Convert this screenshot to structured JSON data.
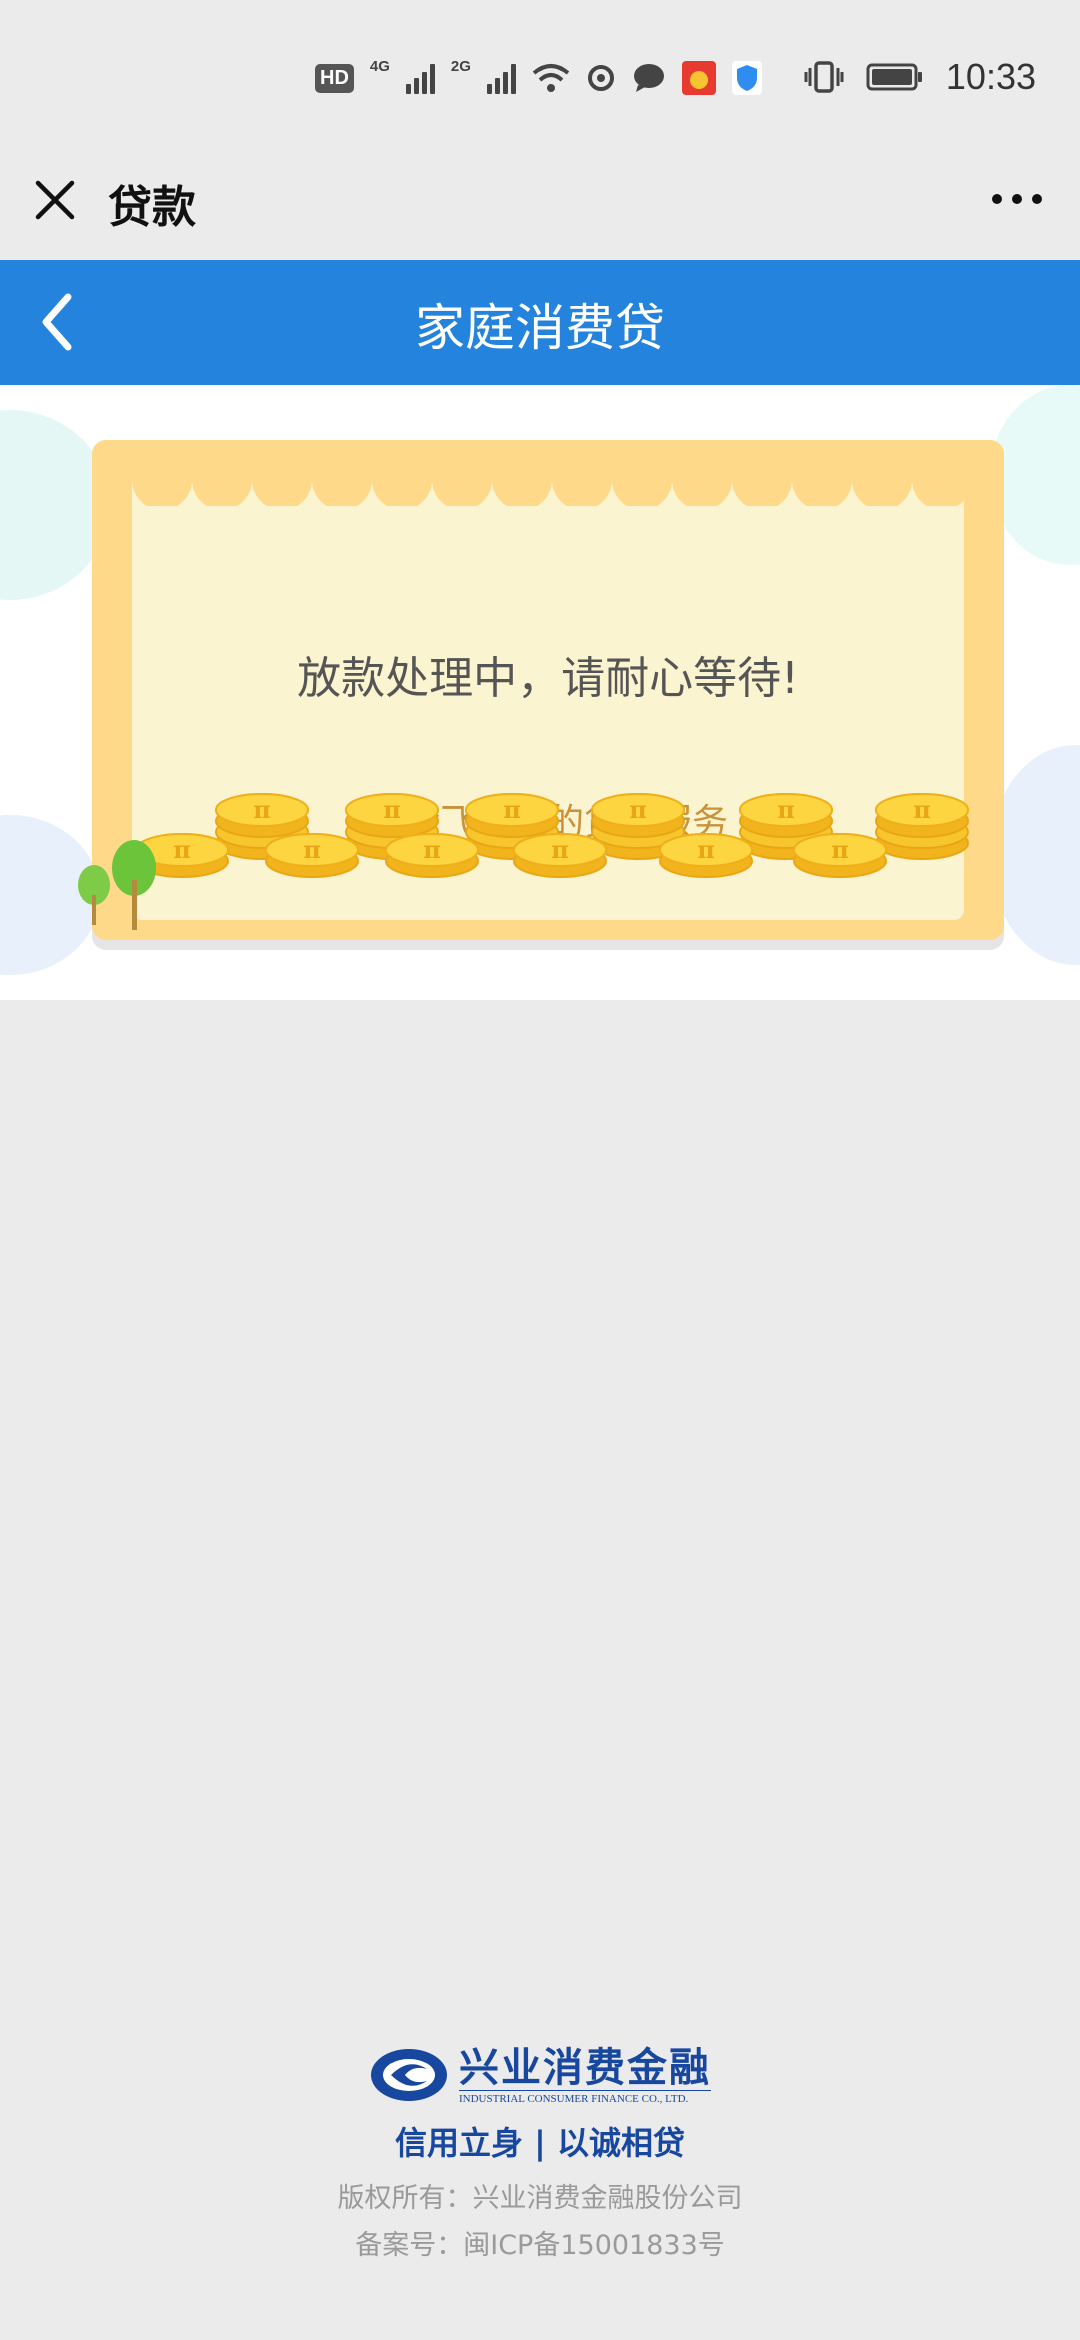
{
  "status_bar": {
    "time": "10:33",
    "hd_label": "HD",
    "net_4g": "4G",
    "net_2g": "2G"
  },
  "wechat_nav": {
    "title": "贷款"
  },
  "header": {
    "title": "家庭消费贷"
  },
  "card": {
    "message": "放款处理中，请耐心等待!",
    "subtitle": "体验飞一般的贷款服务",
    "coin_symbol": "π"
  },
  "footer": {
    "brand_cn": "兴业消费金融",
    "brand_en": "INDUSTRIAL CONSUMER FINANCE CO., LTD.",
    "slogan": "信用立身 | 以诚相贷",
    "copyright": "版权所有：兴业消费金融股份公司",
    "icp": "备案号：闽ICP备15001833号"
  },
  "colors": {
    "header_blue": "#2483dc",
    "card_outer": "#fed98a",
    "card_inner": "#fbf4d0",
    "subtitle": "#c9923a",
    "brand_blue": "#17479e"
  },
  "icons": [
    "close-icon",
    "more-icon",
    "back-icon",
    "wifi-icon",
    "vibrate-icon",
    "battery-icon"
  ]
}
